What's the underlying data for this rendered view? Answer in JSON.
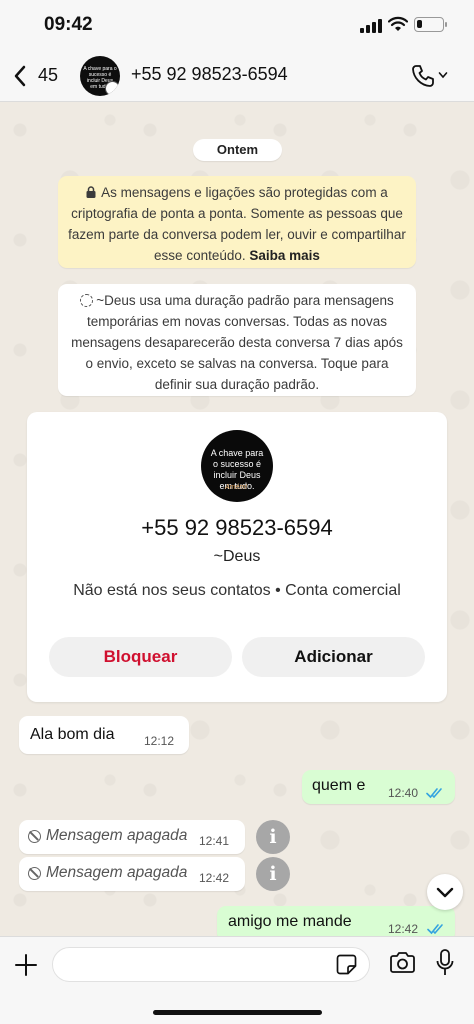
{
  "status_bar": {
    "time": "09:42",
    "battery_percent": 20
  },
  "header": {
    "back_count": "45",
    "contact_name": "+55 92 98523-6594",
    "avatar_text": "A chave para o sucesso é incluir Deus em tudo."
  },
  "chat": {
    "date_label": "Ontem",
    "encryption_notice": {
      "text": "As mensagens e ligações são protegidas com a criptografia de ponta a ponta. Somente as pessoas que fazem parte da conversa podem ler, ouvir e compartilhar esse conteúdo.",
      "link": "Saiba mais"
    },
    "temporary_notice": "~Deus usa uma duração padrão para mensagens temporárias em novas conversas. Todas as novas mensagens desaparecerão desta conversa 7 dias após o envio, exceto se salvas na conversa. Toque para definir sua duração padrão.",
    "contact_card": {
      "avatar_text": "A chave para o sucesso é incluir Deus em tudo.",
      "avatar_signature": "Amém!",
      "phone": "+55 92 98523-6594",
      "name": "~Deus",
      "subtitle": "Não está nos seus contatos • Conta comercial",
      "block_label": "Bloquear",
      "add_label": "Adicionar"
    },
    "messages": [
      {
        "direction": "in",
        "text": "Ala bom dia",
        "time": "12:12"
      },
      {
        "direction": "out",
        "text": "quem e",
        "time": "12:40",
        "status": "read"
      },
      {
        "direction": "in",
        "text": "Mensagem apagada",
        "time": "12:41",
        "deleted": true
      },
      {
        "direction": "in",
        "text": "Mensagem apagada",
        "time": "12:42",
        "deleted": true
      },
      {
        "direction": "out",
        "text": "amigo me mande",
        "time": "12:42",
        "status": "read"
      }
    ],
    "info_glyph": "i"
  },
  "composer": {
    "placeholder": ""
  },
  "colors": {
    "outgoing_bubble": "#d9fdd3",
    "incoming_bubble": "#ffffff",
    "encryption_notice_bg": "#fdf3c5",
    "block_text": "#d0102f",
    "read_ticks": "#34a3e0",
    "chat_background": "#efeae2"
  }
}
